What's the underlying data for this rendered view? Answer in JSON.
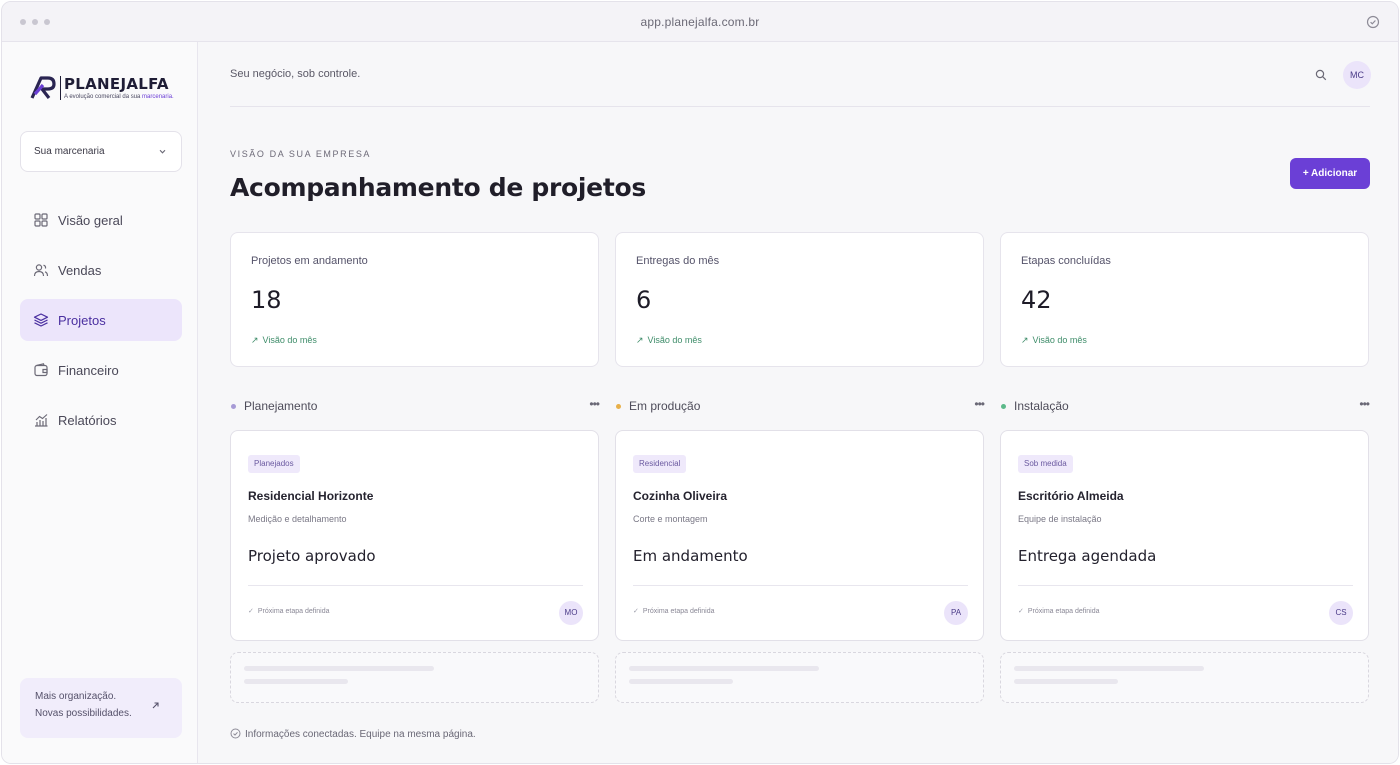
{
  "browser": {
    "url": "app.planejalfa.com.br"
  },
  "brand": {
    "name": "PLANEJALFA",
    "tagline_prefix": "A evolução comercial da sua ",
    "tagline_highlight": "marcenaria."
  },
  "sidebar": {
    "selector_label": "Sua marcenaria",
    "items": [
      {
        "label": "Visão geral",
        "icon": "grid-icon",
        "active": false
      },
      {
        "label": "Vendas",
        "icon": "users-icon",
        "active": false
      },
      {
        "label": "Projetos",
        "icon": "layers-icon",
        "active": true
      },
      {
        "label": "Financeiro",
        "icon": "wallet-icon",
        "active": false
      },
      {
        "label": "Relatórios",
        "icon": "chart-icon",
        "active": false
      }
    ],
    "promo": {
      "line1": "Mais organização.",
      "line2": "Novas possibilidades."
    }
  },
  "header": {
    "tagline": "Seu negócio, sob controle.",
    "avatar_initials": "MC"
  },
  "page": {
    "eyebrow": "VISÃO DA SUA EMPRESA",
    "title": "Acompanhamento de projetos",
    "add_button": "+ Adicionar"
  },
  "stats": [
    {
      "label": "Projetos em andamento",
      "value": "18",
      "trend": "Visão do mês"
    },
    {
      "label": "Entregas do mês",
      "value": "6",
      "trend": "Visão do mês"
    },
    {
      "label": "Etapas concluídas",
      "value": "42",
      "trend": "Visão do mês"
    }
  ],
  "columns": [
    {
      "title": "Planejamento",
      "dot_color": "#a79bd6",
      "card": {
        "badge": "Planejados",
        "title": "Residencial Horizonte",
        "subtitle": "Medição e detalhamento",
        "status": "Projeto aprovado",
        "next": "Próxima etapa definida",
        "avatar": "MO"
      }
    },
    {
      "title": "Em produção",
      "dot_color": "#e8b04a",
      "card": {
        "badge": "Residencial",
        "title": "Cozinha Oliveira",
        "subtitle": "Corte e montagem",
        "status": "Em andamento",
        "next": "Próxima etapa definida",
        "avatar": "PA"
      }
    },
    {
      "title": "Instalação",
      "dot_color": "#5cb98a",
      "card": {
        "badge": "Sob medida",
        "title": "Escritório Almeida",
        "subtitle": "Equipe de instalação",
        "status": "Entrega agendada",
        "next": "Próxima etapa definida",
        "avatar": "CS"
      }
    }
  ],
  "footer": {
    "text": "Informações conectadas. Equipe na mesma página."
  },
  "colors": {
    "accent": "#6b3fd6",
    "active_bg": "#ece5fb",
    "trend": "#3f8d6a"
  }
}
